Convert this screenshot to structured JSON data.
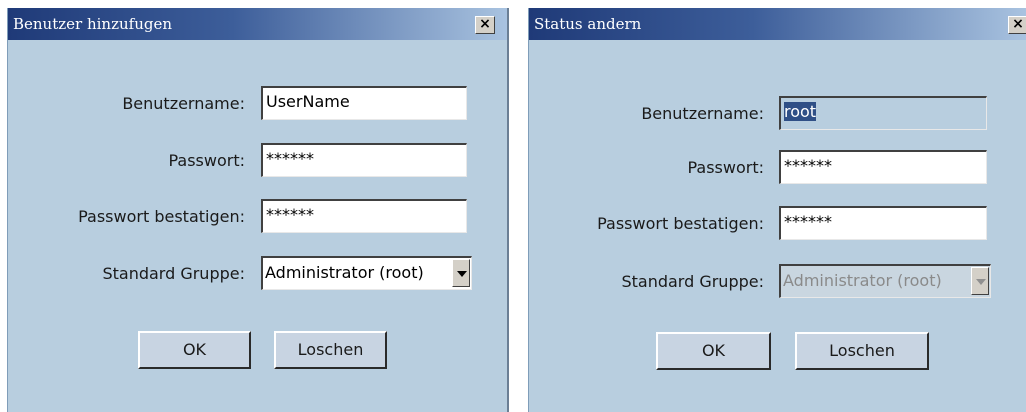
{
  "dialogs": [
    {
      "title": "Benutzer hinzufugen",
      "close_glyph": "×",
      "labels": {
        "username": "Benutzername:",
        "password": "Passwort:",
        "confirm": "Passwort bestatigen:",
        "group": "Standard Gruppe:"
      },
      "values": {
        "username": "UserName",
        "password": "******",
        "confirm": "******",
        "group": "Administrator (root)"
      },
      "buttons": {
        "ok": "OK",
        "delete": "Loschen"
      }
    },
    {
      "title": "Status andern",
      "close_glyph": "×",
      "labels": {
        "username": "Benutzername:",
        "password": "Passwort:",
        "confirm": "Passwort bestatigen:",
        "group": "Standard Gruppe:"
      },
      "values": {
        "username": "root",
        "password": "******",
        "confirm": "******",
        "group": "Administrator (root)"
      },
      "buttons": {
        "ok": "OK",
        "delete": "Loschen"
      }
    }
  ],
  "icons": {
    "close": "close-icon",
    "dropdown": "chevron-down-icon"
  }
}
